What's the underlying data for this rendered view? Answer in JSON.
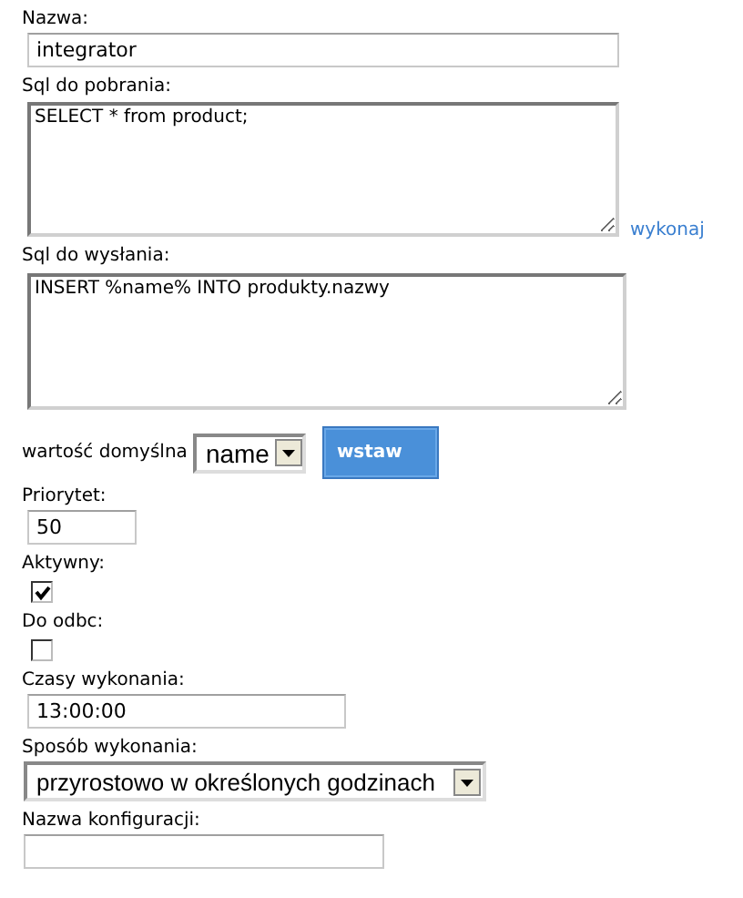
{
  "name": {
    "label": "Nazwa:",
    "value": "integrator"
  },
  "sql_fetch": {
    "label": "Sql do pobrania:",
    "value": "SELECT * from product;",
    "link": "wykonaj"
  },
  "sql_send": {
    "label": "Sql do wysłania:",
    "value": "INSERT %name% INTO produkty.nazwy"
  },
  "default_value": {
    "label": "wartość domyślna",
    "select": "name",
    "button": "wstaw"
  },
  "priority": {
    "label": "Priorytet:",
    "value": "50"
  },
  "active": {
    "label": "Aktywny:",
    "checked": true
  },
  "odbc": {
    "label": "Do odbc:",
    "checked": false
  },
  "times": {
    "label": "Czasy wykonania:",
    "value": "13:00:00"
  },
  "mode": {
    "label": "Sposób wykonania:",
    "select": "przyrostowo w określonych godzinach"
  },
  "config_name": {
    "label": "Nazwa konfiguracji:"
  }
}
